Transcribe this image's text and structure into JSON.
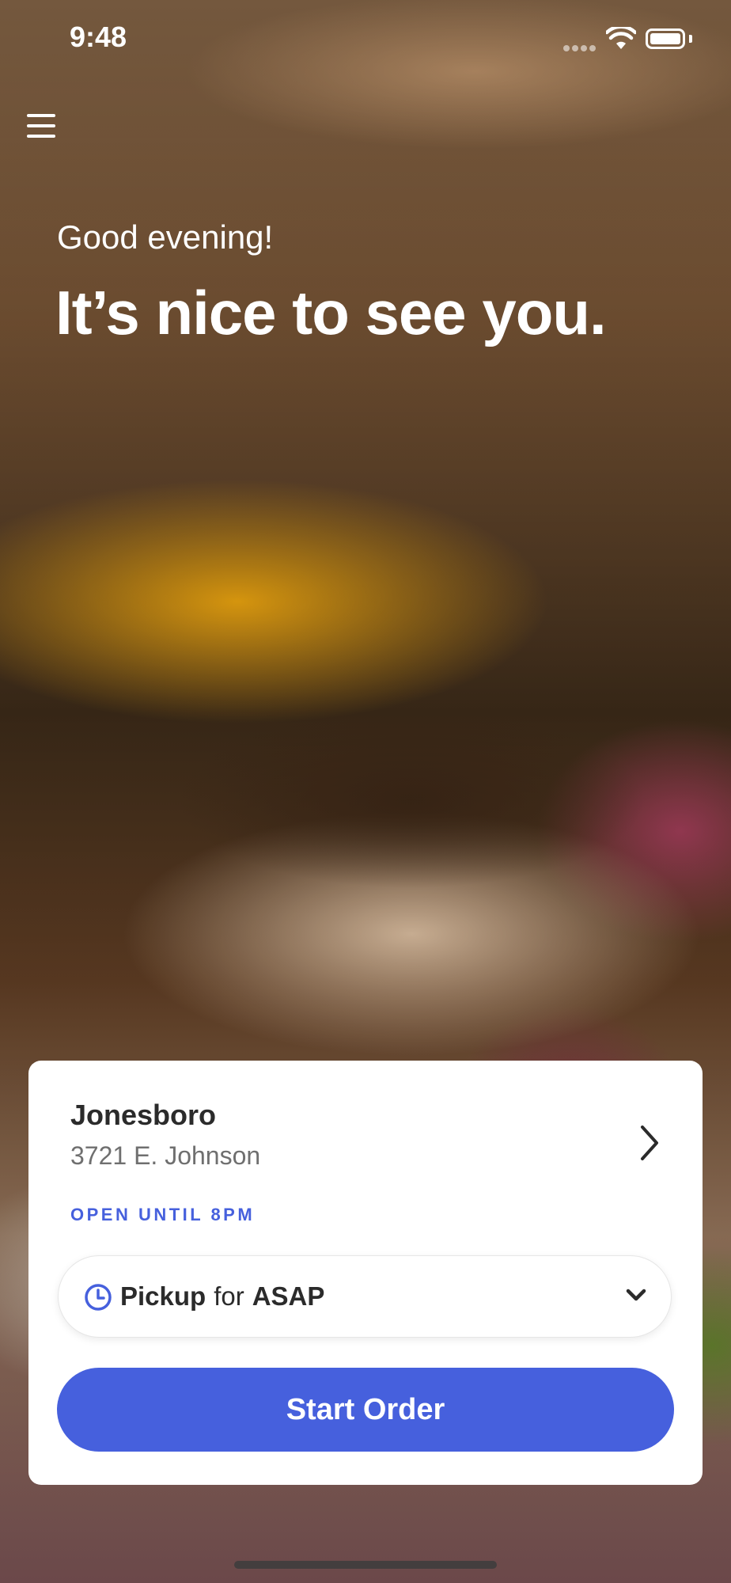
{
  "status_bar": {
    "time": "9:48"
  },
  "header": {
    "menu_icon": "hamburger-menu-icon",
    "greeting": "Good evening!",
    "headline": "It’s nice to see you."
  },
  "store_card": {
    "store_name": "Jonesboro",
    "address": "3721 E. Johnson",
    "hours": "OPEN UNTIL 8PM",
    "order_type": {
      "mode": "Pickup",
      "connector": "for",
      "time": "ASAP",
      "icon": "clock-icon"
    },
    "start_button_label": "Start Order"
  },
  "colors": {
    "accent": "#4660dd",
    "card_background": "#ffffff",
    "text_primary": "#2b2b2b",
    "text_secondary": "#6f6f6f"
  }
}
